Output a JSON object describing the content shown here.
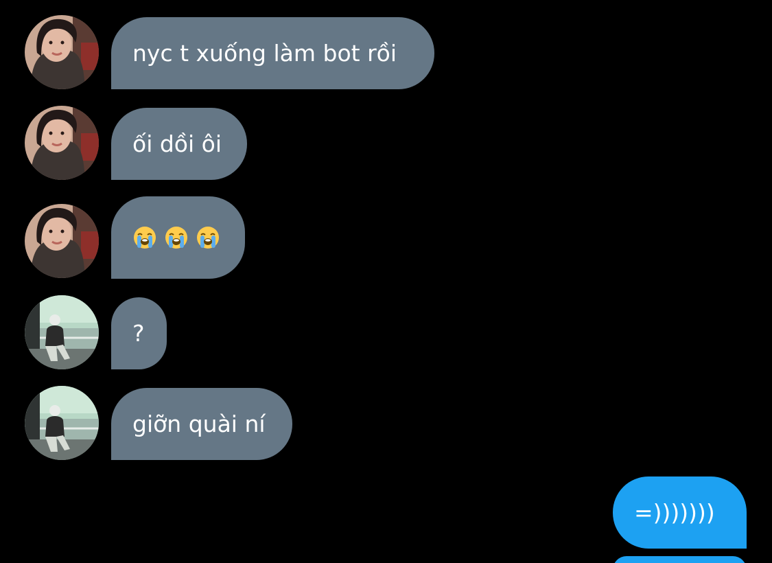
{
  "messages": [
    {
      "sender": "her",
      "text": "nyc t xuống làm bot rồi"
    },
    {
      "sender": "her",
      "text": "ối dồi ôi"
    },
    {
      "sender": "her",
      "emojis": [
        "loudly-crying-face",
        "loudly-crying-face",
        "loudly-crying-face"
      ]
    },
    {
      "sender": "him",
      "text": "?"
    },
    {
      "sender": "him",
      "text": "giỡn quài ní"
    },
    {
      "sender": "me",
      "text": "=)))))))"
    }
  ],
  "colors": {
    "background": "#000000",
    "incoming_bubble": "#657786",
    "outgoing_bubble": "#1da1f2",
    "text": "#ffffff"
  }
}
